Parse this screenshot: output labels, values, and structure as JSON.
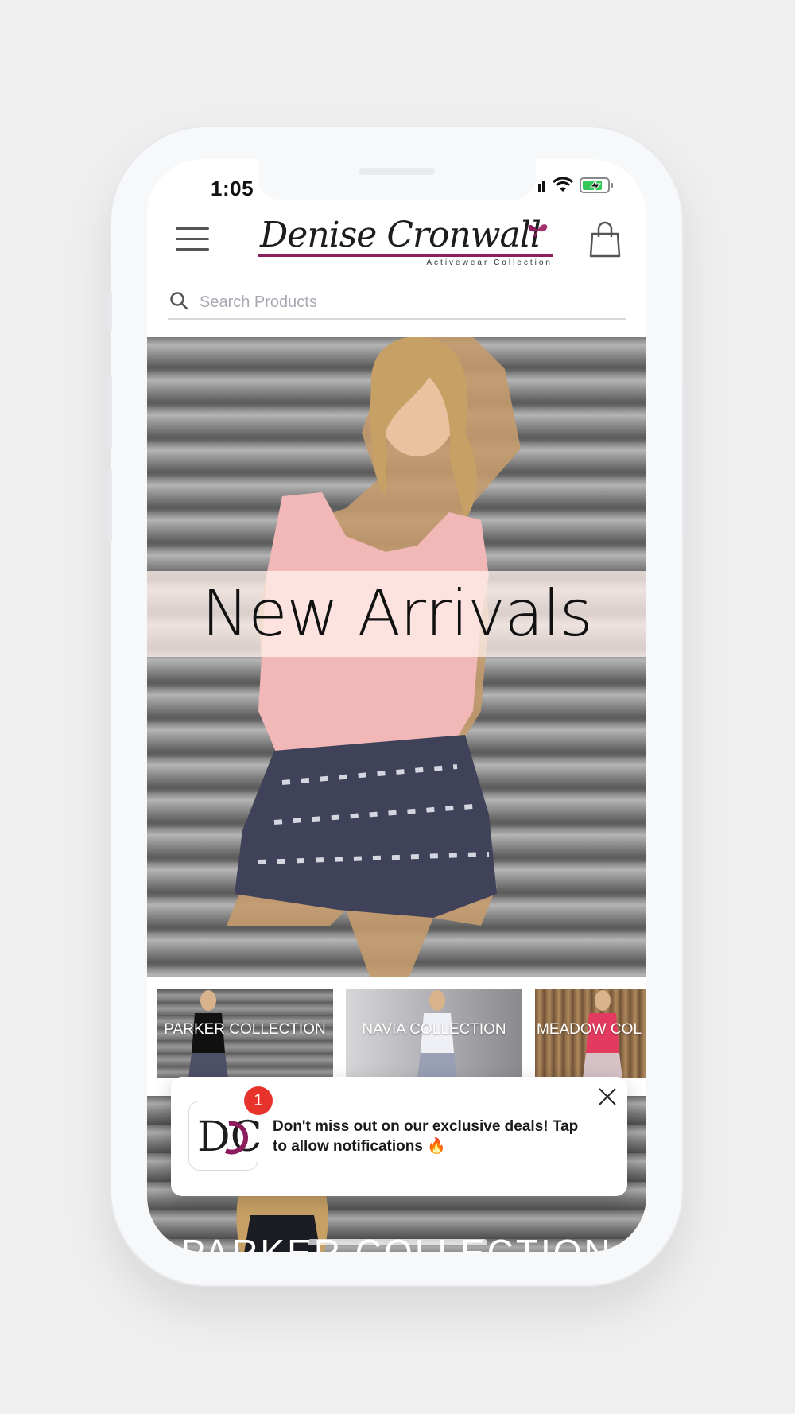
{
  "status_bar": {
    "time": "1:05",
    "signal_icon": "signal-icon",
    "wifi_icon": "wifi-icon",
    "battery_icon": "battery-charging-icon",
    "battery_color": "#34c759"
  },
  "header": {
    "menu_icon": "hamburger-menu-icon",
    "logo_text": "Denise Cronwall",
    "logo_subtitle": "Activewear Collection",
    "cart_icon": "shopping-bag-icon",
    "brand_color": "#8c1e5e"
  },
  "search": {
    "placeholder": "Search Products",
    "icon": "search-icon"
  },
  "hero": {
    "title": "New Arrivals"
  },
  "collections": [
    {
      "label": "PARKER COLLECTION"
    },
    {
      "label": "NAVIA COLLECTION"
    },
    {
      "label": "MEADOW COL"
    }
  ],
  "section_below": {
    "title": "PARKER COLLECTION"
  },
  "notification": {
    "badge_count": "1",
    "logo_text": "DC",
    "message": "Don't miss out on our exclusive deals! Tap to allow notifications 🔥",
    "close_icon": "close-icon",
    "badge_color": "#e8322c"
  }
}
